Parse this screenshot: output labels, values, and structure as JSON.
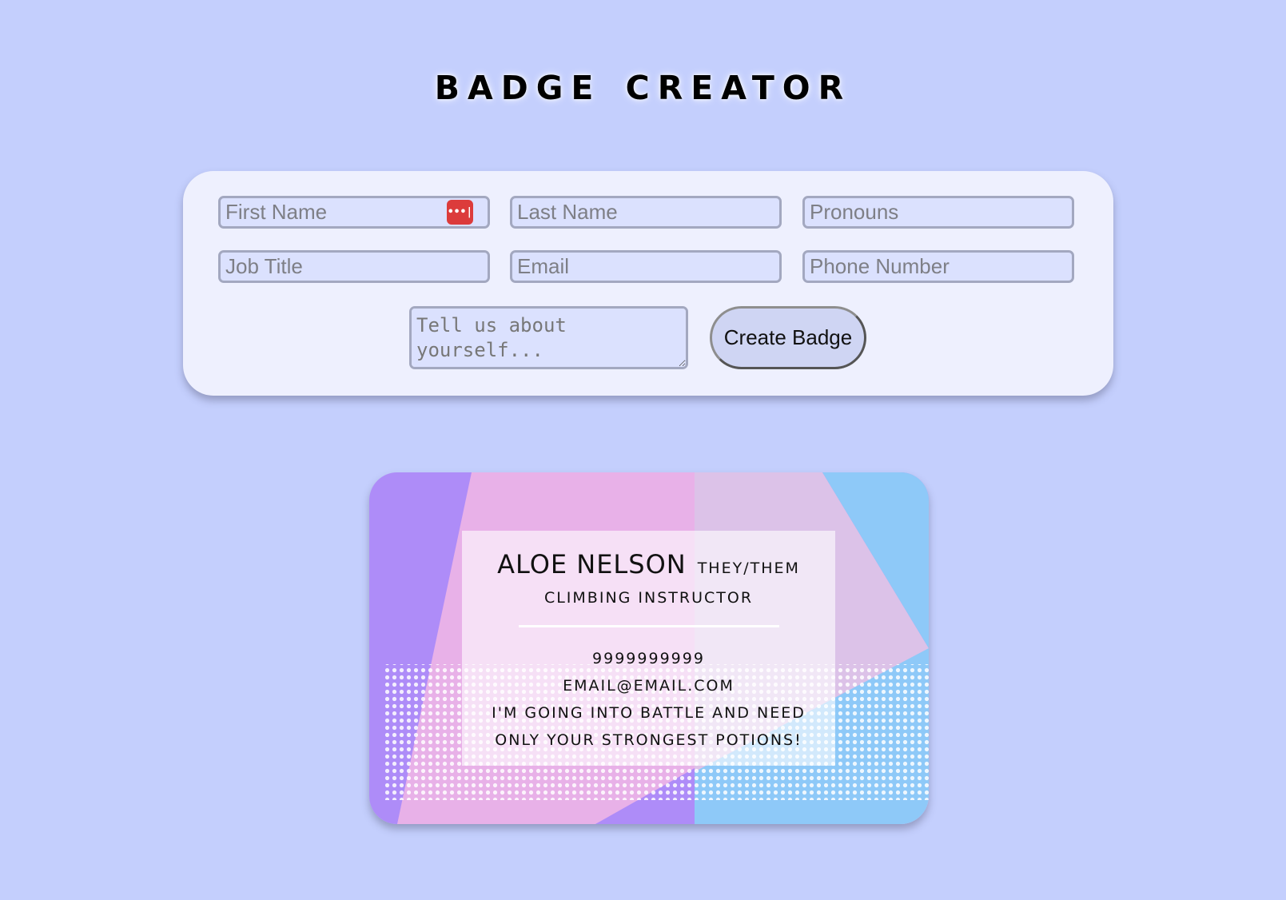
{
  "header": {
    "title": "Badge Creator"
  },
  "form": {
    "first_name_placeholder": "First Name",
    "last_name_placeholder": "Last Name",
    "pronouns_placeholder": "Pronouns",
    "job_title_placeholder": "Job Title",
    "email_placeholder": "Email",
    "phone_placeholder": "Phone Number",
    "bio_placeholder": "Tell us about yourself...",
    "password_manager_icon": "password-manager-icon",
    "create_button_label": "Create Badge"
  },
  "badge": {
    "name": "ALOE NELSON",
    "pronouns": "THEY/THEM",
    "job_title": "CLIMBING INSTRUCTOR",
    "phone": "9999999999",
    "email": "EMAIL@EMAIL.COM",
    "bio": "I'M GOING INTO BATTLE AND NEED ONLY YOUR STRONGEST POTIONS!",
    "colors": {
      "purple": "#ae8cf8",
      "pink": "#e8b1e8",
      "light_pink": "#dcc2e8",
      "blue": "#8ec9f8"
    }
  }
}
